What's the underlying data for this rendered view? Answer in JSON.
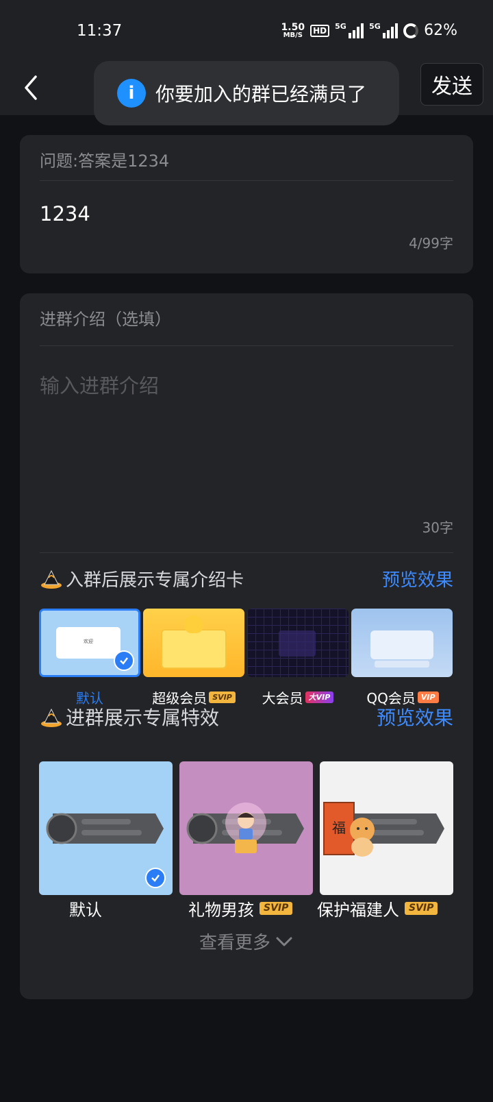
{
  "status": {
    "time": "11:37",
    "speed_value": "1.50",
    "speed_unit": "MB/S",
    "hd": "HD",
    "net1": "5G",
    "net2": "5G",
    "battery": "62%"
  },
  "nav": {
    "send": "发送"
  },
  "toast": {
    "icon": "i",
    "text": "你要加入的群已经满员了"
  },
  "question": {
    "label": "问题:答案是1234",
    "answer": "1234",
    "count": "4/99字"
  },
  "intro": {
    "label": "进群介绍（选填）",
    "placeholder": "输入进群介绍",
    "count": "30字"
  },
  "intro_card": {
    "title": "入群后展示专属介绍卡",
    "preview": "预览效果",
    "items": [
      {
        "label": "默认",
        "badge": "",
        "selected": true
      },
      {
        "label": "超级会员",
        "badge": "SVIP"
      },
      {
        "label": "大会员",
        "badge": "大VIP"
      },
      {
        "label": "QQ会员",
        "badge": "VIP"
      }
    ],
    "thumb_text": "欢迎"
  },
  "effects": {
    "title": "进群展示专属特效",
    "preview": "预览效果",
    "items": [
      {
        "label": "默认",
        "badge": "",
        "selected": true
      },
      {
        "label": "礼物男孩",
        "badge": "SVIP"
      },
      {
        "label": "保护福建人",
        "badge": "SVIP"
      }
    ],
    "fu": "福",
    "more": "查看更多"
  },
  "colors": {
    "accent": "#3d8bff",
    "background": "#111215",
    "card": "#232427"
  }
}
